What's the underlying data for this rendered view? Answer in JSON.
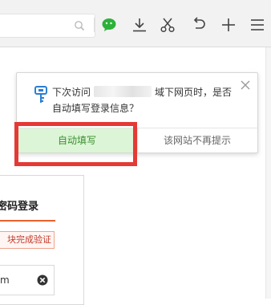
{
  "popup": {
    "message_prefix": "下次访问",
    "message_suffix": "域下网页时，是否自动填写登录信息？",
    "fill_button": "自动填写",
    "dont_prompt_button": "该网站不再提示"
  },
  "login": {
    "title": "密码登录",
    "verify_text": "块完成验证",
    "input_value": "m"
  },
  "toolbar": {
    "icons": [
      "search-icon",
      "wechat-icon",
      "download-icon",
      "scissors-icon",
      "undo-icon",
      "plus-icon",
      "menu-icon"
    ]
  },
  "colors": {
    "highlight": "#e53935",
    "fill_button_bg": "#dcf5d6",
    "fill_button_text": "#3a8f2f",
    "wechat": "#2db13a",
    "accent_orange": "#e8612c"
  }
}
